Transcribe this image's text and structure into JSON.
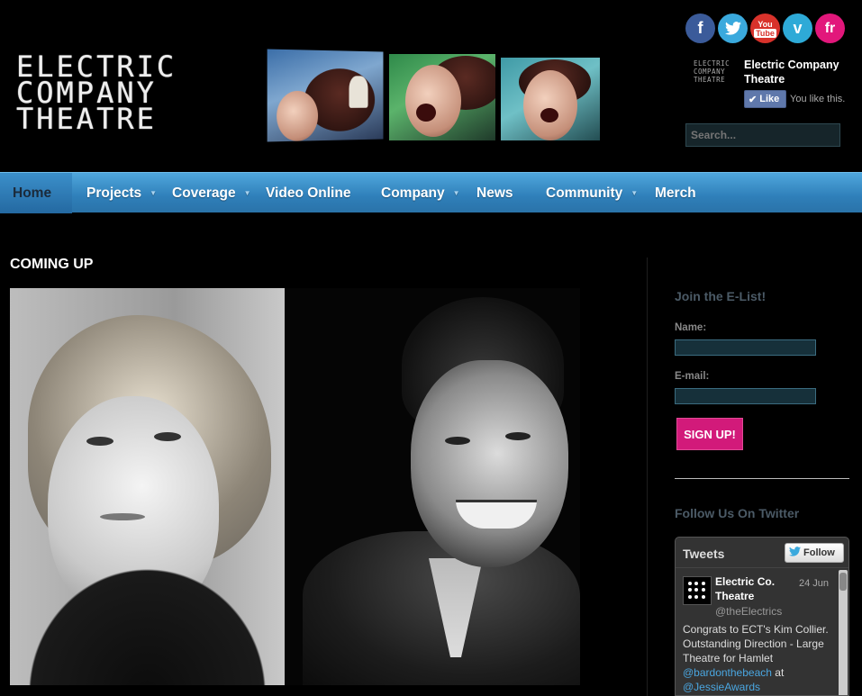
{
  "logo": {
    "line1": "ELECTRIC",
    "line2": "COMPANY",
    "line3": "THEATRE"
  },
  "social": [
    {
      "name": "facebook",
      "glyph": "f"
    },
    {
      "name": "twitter",
      "glyph": "t"
    },
    {
      "name": "youtube",
      "glyph": "You Tube"
    },
    {
      "name": "vimeo",
      "glyph": "v"
    },
    {
      "name": "french",
      "glyph": "fr"
    }
  ],
  "facebook_widget": {
    "thumb_text": "ELECTRIC COMPANY THEATRE",
    "page_name": "Electric Company Theatre",
    "like_label": "Like",
    "likes_text": "You like this."
  },
  "search": {
    "placeholder": "Search..."
  },
  "nav": {
    "items": [
      {
        "label": "Home",
        "has_submenu": false,
        "active": true
      },
      {
        "label": "Projects",
        "has_submenu": true
      },
      {
        "label": "Coverage",
        "has_submenu": true
      },
      {
        "label": "Video Online",
        "has_submenu": false
      },
      {
        "label": "Company",
        "has_submenu": true
      },
      {
        "label": "News",
        "has_submenu": false
      },
      {
        "label": "Community",
        "has_submenu": true
      },
      {
        "label": "Merch",
        "has_submenu": false
      }
    ]
  },
  "main": {
    "section_title": "COMING UP"
  },
  "sidebar": {
    "elist": {
      "heading": "Join the E-List!",
      "name_label": "Name:",
      "email_label": "E-mail:",
      "signup_label": "SIGN UP!"
    },
    "twitter": {
      "heading": "Follow Us On Twitter",
      "widget_title": "Tweets",
      "follow_label": "Follow",
      "tweet": {
        "author": "Electric Co. Theatre",
        "handle": "@theElectrics",
        "date": "24 Jun",
        "text_pre": "Congrats to ECT's Kim Collier. Outstanding Direction - Large Theatre for Hamlet ",
        "mention1": "@bardonthebeach",
        "text_mid": " at ",
        "mention2": "@JessieAwards"
      }
    }
  },
  "colors": {
    "nav_blue": "#2f7fb9",
    "signup_pink": "#d21a7a",
    "background": "#000000"
  }
}
